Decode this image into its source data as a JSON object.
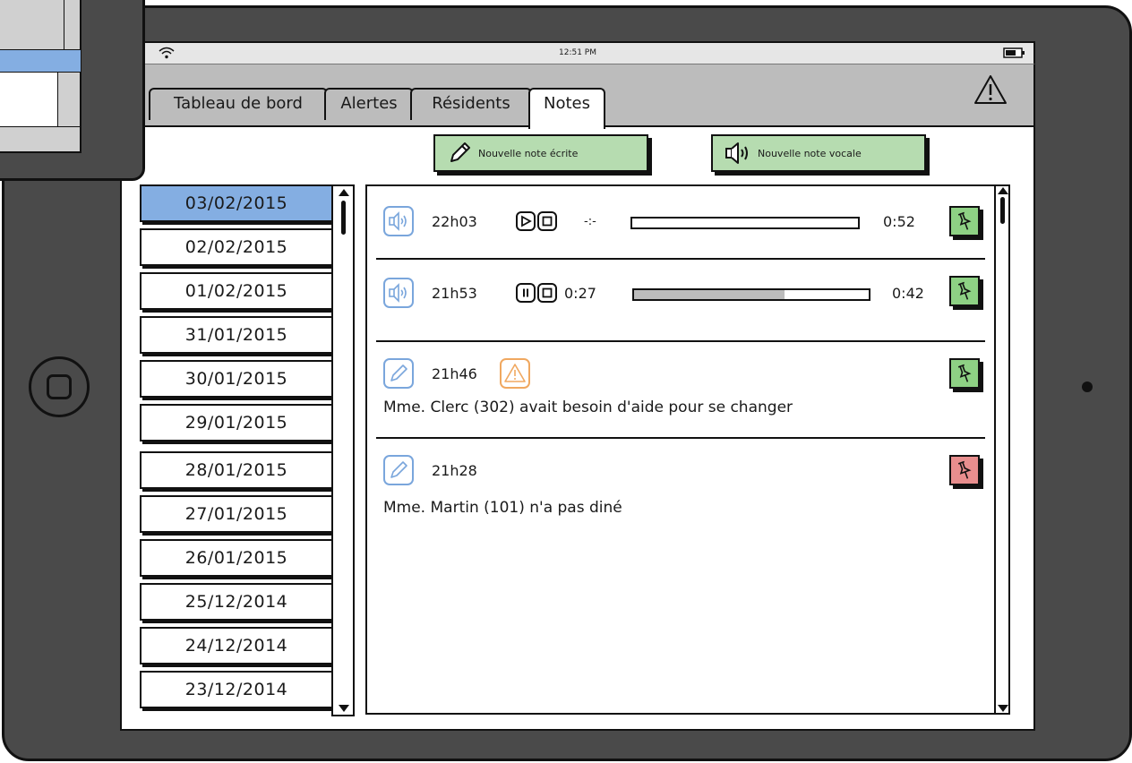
{
  "status_bar": {
    "time": "12:51 PM"
  },
  "tabs": [
    {
      "label": "Tableau de bord",
      "active": false
    },
    {
      "label": "Alertes",
      "active": false
    },
    {
      "label": "Résidents",
      "active": false
    },
    {
      "label": "Notes",
      "active": true
    }
  ],
  "actions": {
    "new_written_note": "Nouvelle note écrite",
    "new_voice_note": "Nouvelle note vocale"
  },
  "dates": [
    {
      "label": "03/02/2015",
      "selected": true
    },
    {
      "label": "02/02/2015"
    },
    {
      "label": "01/02/2015"
    },
    {
      "label": "31/01/2015"
    },
    {
      "label": "30/01/2015"
    },
    {
      "label": "29/01/2015"
    },
    {
      "label": "28/01/2015"
    },
    {
      "label": "27/01/2015"
    },
    {
      "label": "26/01/2015"
    },
    {
      "label": "25/12/2014"
    },
    {
      "label": "24/12/2014"
    },
    {
      "label": "23/12/2014"
    }
  ],
  "notes": [
    {
      "type": "voice",
      "time": "22h03",
      "position": "-:-",
      "duration": "0:52",
      "state": "stopped",
      "progress": 0,
      "pin_color": "#8ed184"
    },
    {
      "type": "voice",
      "time": "21h53",
      "position": "0:27",
      "duration": "0:42",
      "state": "playing",
      "progress": 0.64,
      "pin_color": "#8ed184"
    },
    {
      "type": "text",
      "time": "21h46",
      "alert": true,
      "text": "Mme. Clerc (302) avait besoin d'aide pour se changer",
      "pin_color": "#8ed184"
    },
    {
      "type": "text",
      "time": "21h28",
      "alert": false,
      "text": "Mme. Martin (101) n'a pas diné",
      "pin_color": "#e88e8e"
    }
  ],
  "colors": {
    "selected_date": "#84aee2",
    "button_green": "#b6dcb0",
    "pin_green": "#8ed184",
    "pin_red": "#e88e8e",
    "icon_blue": "#7aa6dc",
    "alert_orange": "#f0a860"
  }
}
